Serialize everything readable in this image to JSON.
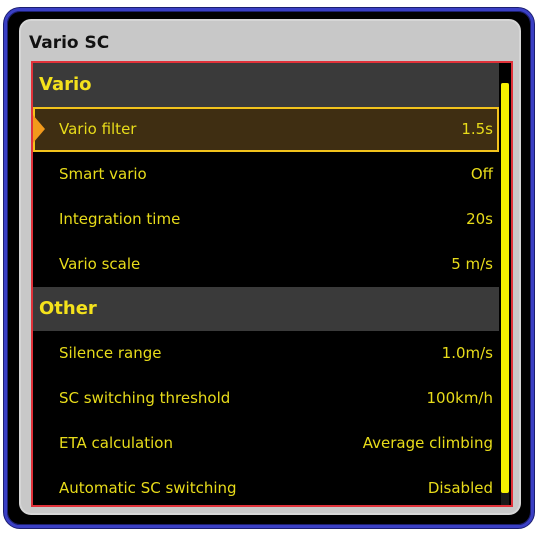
{
  "dialog": {
    "title": "Vario SC"
  },
  "sections": [
    {
      "header": "Vario",
      "rows": [
        {
          "label": "Vario filter",
          "value": "1.5s"
        },
        {
          "label": "Smart vario",
          "value": "Off"
        },
        {
          "label": "Integration time",
          "value": "20s"
        },
        {
          "label": "Vario scale",
          "value": "5 m/s"
        }
      ]
    },
    {
      "header": "Other",
      "rows": [
        {
          "label": "Silence range",
          "value": "1.0m/s"
        },
        {
          "label": "SC switching threshold",
          "value": "100km/h"
        },
        {
          "label": "ETA calculation",
          "value": "Average climbing"
        },
        {
          "label": "Automatic SC switching",
          "value": "Disabled"
        }
      ]
    }
  ],
  "selected_row": "Vario filter",
  "scroll_position": 0,
  "colors": {
    "text": "#e8dc1a",
    "header_text": "#f4e21c",
    "selection_border": "#f2c31c",
    "selection_fill": "#3f2e12",
    "list_border": "#e0323a",
    "frame_border": "#3a3fc4",
    "scroll_thumb": "#f6f000"
  }
}
